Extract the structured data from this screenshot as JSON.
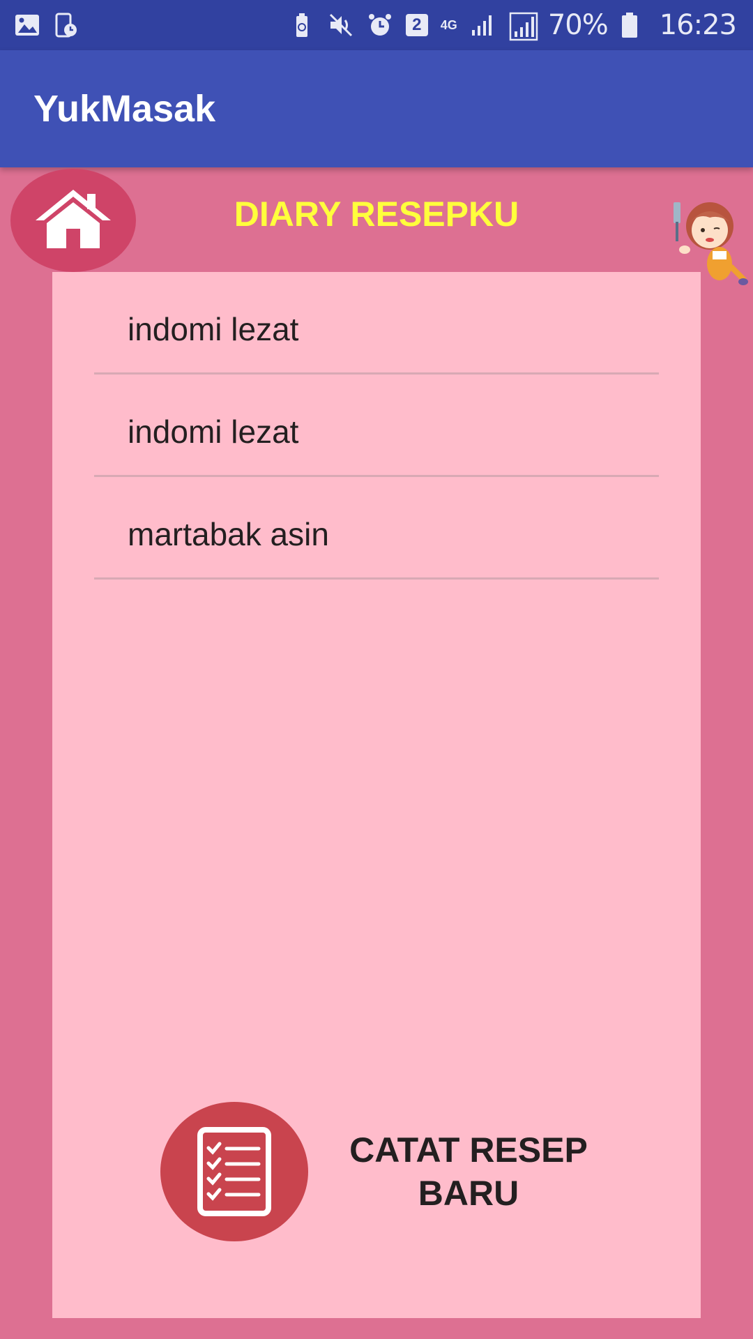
{
  "status_bar": {
    "notification_count": "2",
    "network": "4G",
    "battery": "70%",
    "time": "16:23"
  },
  "app_bar": {
    "title": "YukMasak"
  },
  "header": {
    "title": "DIARY RESEPKU"
  },
  "recipes": [
    {
      "name": "indomi lezat"
    },
    {
      "name": "indomi lezat"
    },
    {
      "name": "martabak asin"
    }
  ],
  "add_button": {
    "label": "CATAT RESEP BARU"
  },
  "colors": {
    "status_bar": "#3141a0",
    "app_bar": "#3f51b5",
    "background": "#dd7092",
    "card": "#ffbccb",
    "title_accent": "#ffff3c",
    "home_button": "#cf4468",
    "add_icon": "#c9444e"
  },
  "icons": {
    "home": "home-icon",
    "add": "checklist-icon",
    "mascot": "chef-mascot"
  }
}
